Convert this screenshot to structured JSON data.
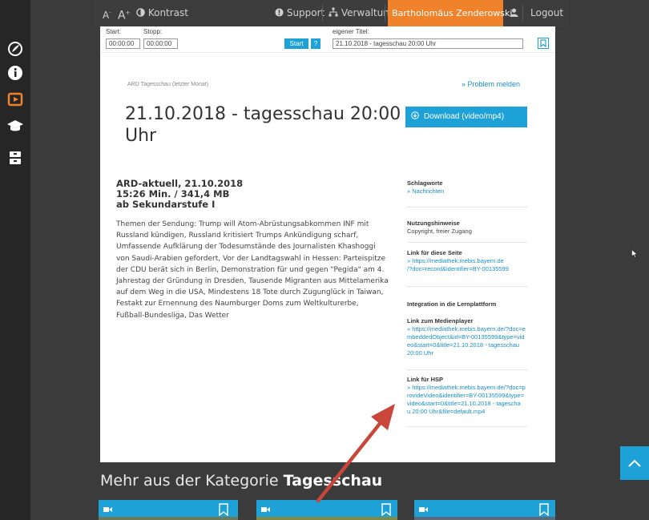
{
  "topbar": {
    "font_smaller": "A",
    "font_larger": "A",
    "contrast_label": "Kontrast",
    "support_label": "Support",
    "verwaltung_label": "Verwaltung",
    "user_name": "Bartholomäus Zenderowski",
    "logout_label": "Logout",
    "user_bg": "#f0822b"
  },
  "player": {
    "start_label": "Start:",
    "stop_label": "Stopp:",
    "start_value": "00:00:00",
    "stop_value": "00:00:00",
    "start_button": "Start",
    "help_button": "?",
    "title_label": "eigener Titel:",
    "title_value": "21.10.2018 - tagesschau 20:00 Uhr"
  },
  "content": {
    "breadcrumb": "ARD Tagesschau (letzter Monat)",
    "report_problem": "» Problem melden",
    "title_line1": "21.10.2018 - tagesschau 20:00",
    "title_line2": "Uhr",
    "download_label": "Download (video/mp4)",
    "source": "ARD-aktuell, 21.10.2018",
    "meta": "15:26 Min. / 341,4 MB",
    "level": "ab Sekundarstufe I",
    "description": [
      "Themen der Sendung: Trump will Atom-Abrüstungsabkommen INF mit",
      "Russland kündigen, Russland kritisiert Trumps Ankündigung scharf,",
      "Umfassende Aufklärung der Todesumstände des Journalisten Khashoggi",
      "von Saudi-Arabien gefordert, Vor der Landtagswahl in Hessen: Parteispitze",
      "der CDU berät sich in Berlin, Demonstration für und gegen \"Pegida\" am 4.",
      "Jahrestag der Gründung in Dresden, Tausende Migranten aus Mittelamerika",
      "auf dem Weg in die USA, Mindestens 18 Tote durch Zugunglück in Taiwan,",
      "Festakt zur Ernennung des Naumburger Doms zum Weltkulturerbe,",
      "Fußball-Bundesliga, Das Wetter"
    ]
  },
  "info": {
    "keywords_heading": "Schlagworte",
    "keywords_value": "» Nachrichten",
    "usage_heading": "Nutzungshinweise",
    "usage_value": "Copyright, freier Zugang",
    "page_link_heading": "Link für diese Seite",
    "page_link_lines": [
      "» https://mediathek.mebis.bayern.de",
      "/?doc=record&identifier=BY-00135599"
    ],
    "integration_heading": "Integration in die Lernplattform",
    "player_link_heading": "Link zum Medienplayer",
    "player_link_lines": [
      "» https://mediathek.mebis.bayern.de/?doc=e",
      "mbeddedObject&id=BY-00135599&type=vid",
      "eo&start=0&title=21.10.2018 - tagesschau",
      "20:00 Uhr"
    ],
    "hsp_link_heading": "Link für HSP",
    "hsp_link_lines": [
      "» https://mediathek.mebis.bayern.de/?doc=p",
      "rovideVideo&identifier=BY-00135599&type=",
      "video&start=0&title=21.10.2018 - tagescha",
      "u 20:00 Uhr&file=default.mp4"
    ]
  },
  "category": {
    "prefix": "Mehr aus der Kategorie ",
    "name": "Tagesschau"
  },
  "colors": {
    "accent": "#1da1d6",
    "link": "#1a8fc7",
    "arrow": "#c8463a",
    "sidebar_active": "#f0822b"
  }
}
